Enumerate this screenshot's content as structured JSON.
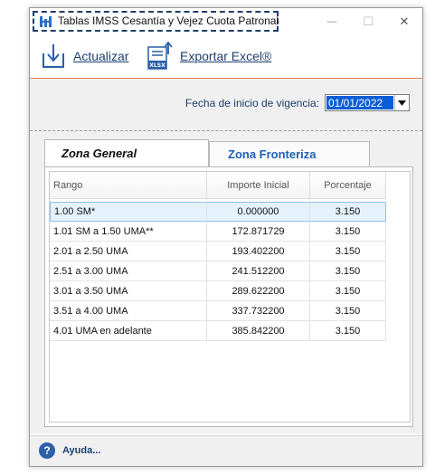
{
  "window": {
    "title": "Tablas IMSS Cesantía y Vejez Cuota Patronal",
    "minimize_glyph": "—",
    "maximize_glyph": "☐",
    "close_glyph": "✕"
  },
  "toolbar": {
    "refresh_label": "Actualizar",
    "export_label": "Exportar Excel®",
    "export_icon_badge": "XLSX"
  },
  "filter": {
    "date_label": "Fecha de inicio de vigencia:",
    "date_value": "01/01/2022"
  },
  "tabs": [
    {
      "label": "Zona General",
      "selected": true
    },
    {
      "label": "Zona Fronteriza",
      "selected": false
    }
  ],
  "table": {
    "columns": [
      "Rango",
      "Importe Inicial",
      "Porcentaje"
    ],
    "rows": [
      [
        "1.00 SM*",
        "0.000000",
        "3.150"
      ],
      [
        "1.01 SM a 1.50 UMA**",
        "172.871729",
        "3.150"
      ],
      [
        "2.01 a 2.50 UMA",
        "193.402200",
        "3.150"
      ],
      [
        "2.51 a 3.00 UMA",
        "241.512200",
        "3.150"
      ],
      [
        "3.01 a 3.50 UMA",
        "289.622200",
        "3.150"
      ],
      [
        "3.51 a 4.00 UMA",
        "337.732200",
        "3.150"
      ],
      [
        "4.01 UMA en adelante",
        "385.842200",
        "3.150"
      ]
    ],
    "selected_row": 0
  },
  "status": {
    "help_label": "Ayuda...",
    "help_icon_glyph": "?"
  },
  "colors": {
    "accent_orange": "#e07b39",
    "link_blue": "#1c3f6e",
    "tab_blue": "#1f5fb8",
    "selection": "#0a5ed6"
  }
}
